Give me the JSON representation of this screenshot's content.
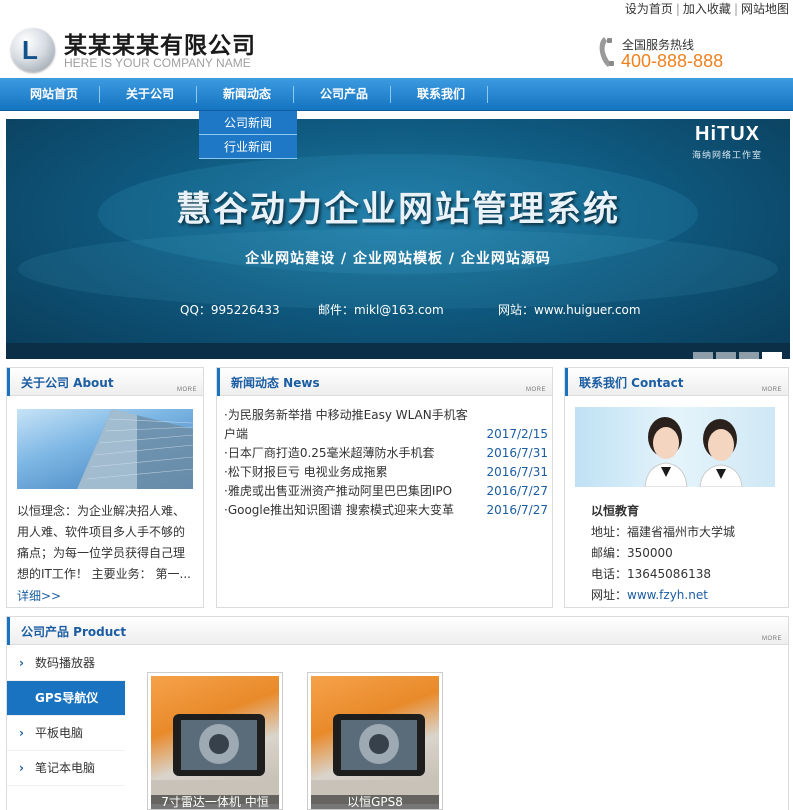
{
  "toplinks": [
    "设为首页",
    "加入收藏",
    "网站地图"
  ],
  "header": {
    "company_name": "某某某某有限公司",
    "company_en": "HERE IS YOUR COMPANY NAME",
    "hotline_label": "全国服务热线",
    "hotline_number": "400-888-888",
    "accent_color": "#f0801e"
  },
  "nav": {
    "items": [
      "网站首页",
      "关于公司",
      "新闻动态",
      "公司产品",
      "联系我们"
    ],
    "dropdown": [
      "公司新闻",
      "行业新闻"
    ]
  },
  "banner": {
    "logo": "HiTUX",
    "logo_sub": "海纳网络工作室",
    "title": "慧谷动力企业网站管理系统",
    "subtitle": "企业网站建设 / 企业网站模板 / 企业网站源码",
    "qq": "QQ：995226433",
    "email": "邮件：mikl@163.com",
    "website": "网站：www.huiguer.com",
    "slides_total": 4,
    "slide_active": 4
  },
  "about": {
    "title": "关于公司 About",
    "more": "MORE",
    "text": "以恒理念：为企业解决招人难、用人难、软件项目多人手不够的痛点；为每一位学员获得自己理想的IT工作！ 主要业务： 第一...",
    "detail_link": "详细>>"
  },
  "news": {
    "title": "新闻动态 News",
    "more": "MORE",
    "items": [
      {
        "title": "·为民服务新举措 中移动推Easy WLAN手机客户端",
        "date": "2017/2/15"
      },
      {
        "title": "·日本厂商打造0.25毫米超薄防水手机套",
        "date": "2016/7/31"
      },
      {
        "title": "·松下财报巨亏 电视业务成拖累",
        "date": "2016/7/31"
      },
      {
        "title": "·雅虎或出售亚洲资产推动阿里巴巴集团IPO",
        "date": "2016/7/27"
      },
      {
        "title": "·Google推出知识图谱 搜索模式迎来大变革",
        "date": "2016/7/27"
      }
    ]
  },
  "contact": {
    "title": "联系我们 Contact",
    "more": "MORE",
    "name": "以恒教育",
    "address": "地址：福建省福州市大学城",
    "postcode": "邮编：350000",
    "phone": "电话：13645086138",
    "web_label": "网址：",
    "web_url": "www.fzyh.net"
  },
  "products": {
    "title": "公司产品 Product",
    "more": "MORE",
    "categories": [
      "数码播放器",
      "GPS导航仪",
      "平板电脑",
      "笔记本电脑"
    ],
    "active_category": "GPS导航仪",
    "items": [
      {
        "caption": "7寸雷达一体机 中恒"
      },
      {
        "caption": "以恒GPS8"
      }
    ]
  },
  "colors": {
    "brand_blue": "#1a73c0",
    "link_blue": "#1b5da2"
  }
}
